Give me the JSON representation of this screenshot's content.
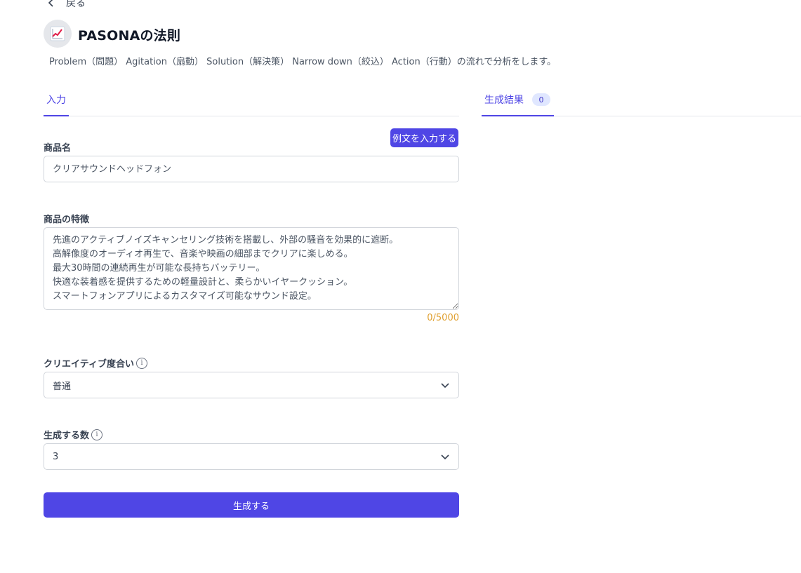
{
  "nav": {
    "back_label": "戻る"
  },
  "header": {
    "icon": "chart-increasing-icon",
    "title": "PASONAの法則",
    "description": "Problem（問題） Agitation（扇動） Solution（解決策） Narrow down（絞込） Action（行動）の流れで分析をします。"
  },
  "tabs": {
    "input_label": "入力",
    "results_label": "生成結果",
    "results_count": "0"
  },
  "form": {
    "example_button_label": "例文を入力する",
    "product_name": {
      "label": "商品名",
      "placeholder": "クリアサウンドヘッドフォン"
    },
    "product_features": {
      "label": "商品の特徴",
      "placeholder": "先進のアクティブノイズキャンセリング技術を搭載し、外部の騒音を効果的に遮断。\n高解像度のオーディオ再生で、音楽や映画の細部までクリアに楽しめる。\n最大30時間の連続再生が可能な長持ちバッテリー。\n快適な装着感を提供するための軽量設計と、柔らかいイヤークッション。\nスマートフォンアプリによるカスタマイズ可能なサウンド設定。",
      "counter": "0/5000"
    },
    "creativity": {
      "label": "クリエイティブ度合い",
      "value": "普通"
    },
    "count": {
      "label": "生成する数",
      "value": "3"
    },
    "info_glyph": "i",
    "generate_button_label": "生成する"
  },
  "colors": {
    "accent": "#4f46e5",
    "counter": "#e0a030",
    "badge_bg": "#e0e7ff"
  }
}
